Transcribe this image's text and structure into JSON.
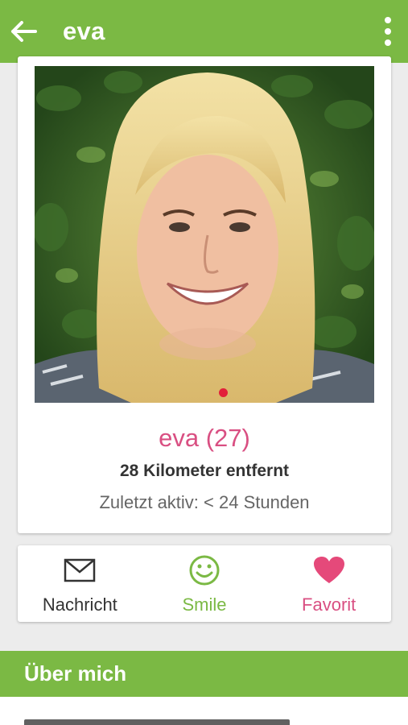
{
  "appbar": {
    "title": "eva",
    "back_icon": "arrow-left-icon",
    "menu_icon": "more-vertical-icon",
    "color": "#7bb944"
  },
  "profile": {
    "name_age": "eva (27)",
    "distance": "28 Kilometer entfernt",
    "last_active": "Zuletzt aktiv: < 24 Stunden",
    "photo_pager": {
      "current": 1,
      "total": 1
    }
  },
  "actions": [
    {
      "label": "Nachricht",
      "icon": "envelope-icon",
      "color": "#333333"
    },
    {
      "label": "Smile",
      "icon": "smiley-icon",
      "color": "#7bb944"
    },
    {
      "label": "Favorit",
      "icon": "heart-icon",
      "color": "#e5497a"
    }
  ],
  "about": {
    "header": "Über mich"
  },
  "colors": {
    "accent_green": "#7bb944",
    "accent_pink": "#d94f82",
    "pager_dot": "#e2203a"
  }
}
